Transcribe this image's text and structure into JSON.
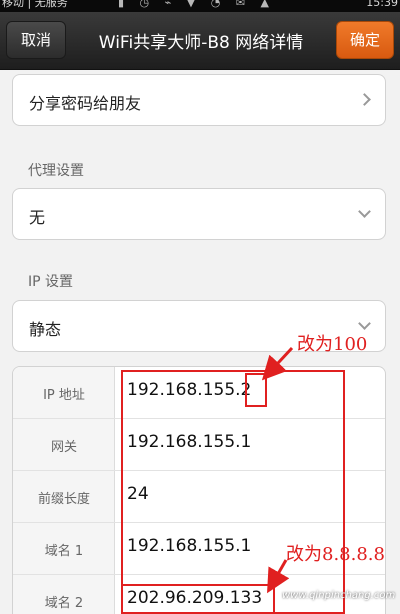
{
  "status_bar": {
    "carrier": "移动 | 无服务",
    "clock": "15:39"
  },
  "header": {
    "cancel_label": "取消",
    "title": "WiFi共享大师-B8 网络详情",
    "confirm_label": "确定"
  },
  "share_row": {
    "label": "分享密码给朋友"
  },
  "proxy": {
    "section_label": "代理设置",
    "selected": "无"
  },
  "ip": {
    "section_label": "IP 设置",
    "selected": "静态"
  },
  "ip_rows": [
    {
      "label": "IP 地址",
      "value": "192.168.155.2"
    },
    {
      "label": "网关",
      "value": "192.168.155.1"
    },
    {
      "label": "前缀长度",
      "value": "24"
    },
    {
      "label": "域名 1",
      "value": "192.168.155.1"
    },
    {
      "label": "域名 2",
      "value": "202.96.209.133"
    }
  ],
  "annotations": {
    "note_ip": "改为100",
    "note_dns": "改为8.8.8.8"
  },
  "watermark": "www.qinpinchang.com",
  "colors": {
    "accent": "#e8671a",
    "annotation": "#e02020"
  }
}
